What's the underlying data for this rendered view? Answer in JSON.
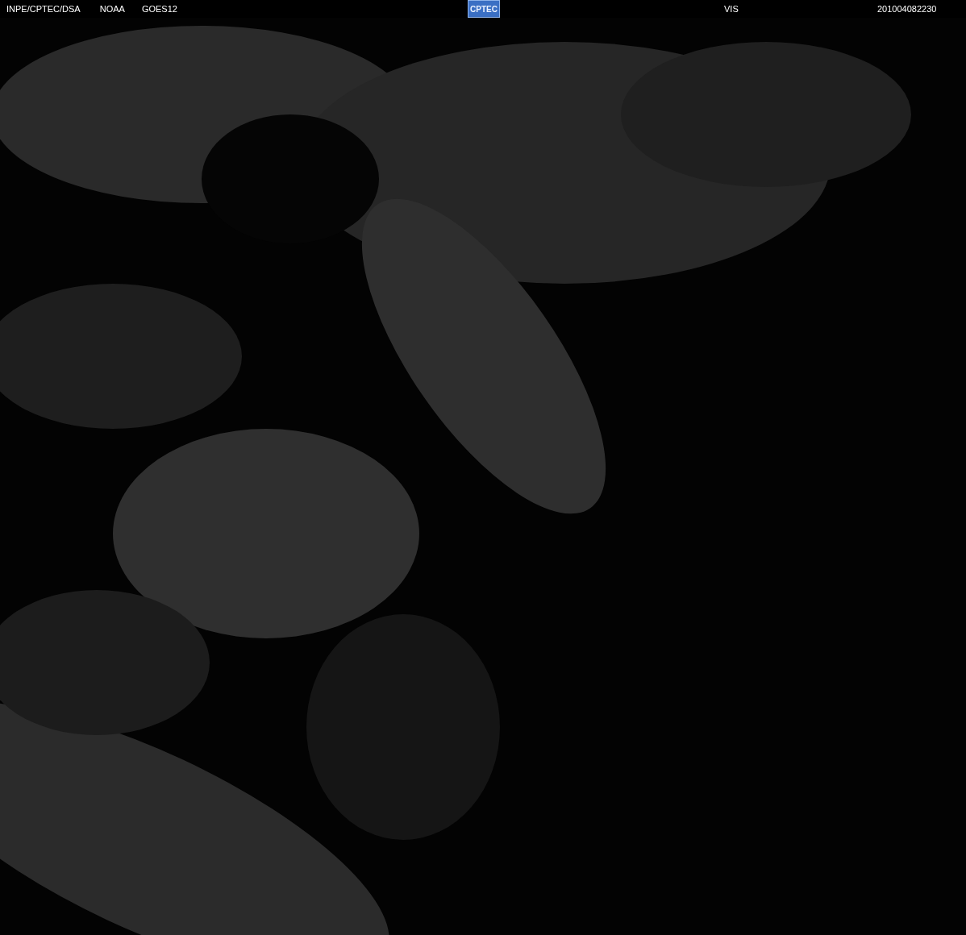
{
  "header": {
    "labels": [
      "INPE/CPTEC/DSA",
      "NOAA",
      "GOES12"
    ],
    "logo": "CPTEC",
    "channel": "VIS",
    "timestamp": "201004082230"
  }
}
